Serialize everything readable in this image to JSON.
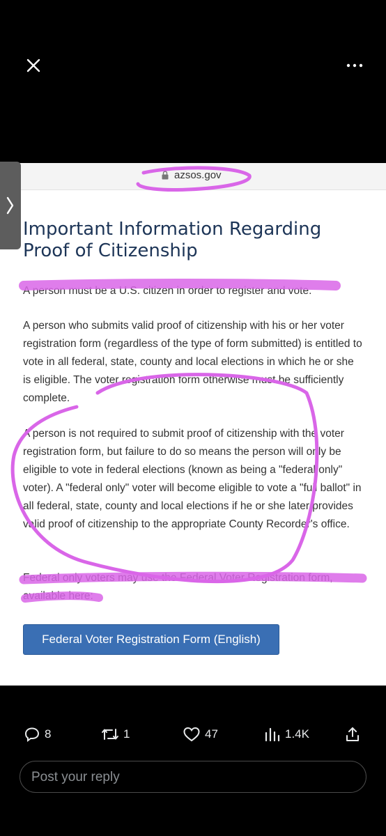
{
  "screenshot": {
    "url": "azsos.gov",
    "title": "Important Information Regarding Proof of Citizenship",
    "paragraphs": [
      "A person must be a U.S. citizen in order to register and vote.",
      "A person who submits valid proof of citizenship with his or her voter registration form (regardless of the type of form submitted) is entitled to vote in all federal, state, county and local elections in which he or she is eligible. The voter registration form otherwise must be sufficiently complete.",
      "A person is not required to submit proof of citizenship with the voter registration form, but failure to do so means the person will only be eligible to vote in federal elections (known as being a \"federal only\" voter). A \"federal only\" voter will become eligible to vote a \"full ballot\" in all federal, state, county and local elections if he or she later provides valid proof of citizenship to the appropriate County Recorder's office.",
      "Federal only voters may use the Federal Voter Registration form, available here:"
    ],
    "button_label": "Federal Voter Registration Form (English)"
  },
  "actions": {
    "replies": "8",
    "reposts": "1",
    "likes": "47",
    "views": "1.4K"
  },
  "reply": {
    "placeholder": "Post your reply"
  },
  "colors": {
    "highlight": "#d966e8",
    "title": "#1d3557",
    "button": "#3a6fb4",
    "background": "#000000"
  },
  "icons": [
    "close-icon",
    "more-icon",
    "chevron-right-icon",
    "lock-icon",
    "reply-icon",
    "repost-icon",
    "like-icon",
    "views-icon",
    "share-icon"
  ]
}
